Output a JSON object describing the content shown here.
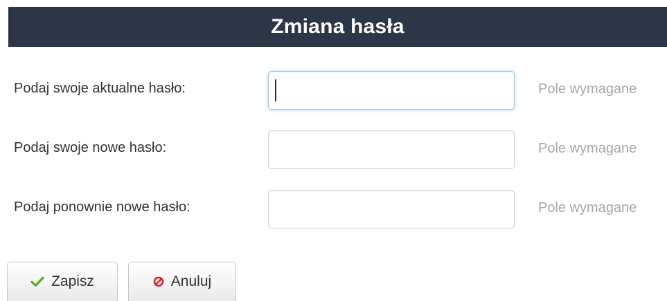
{
  "header": {
    "title": "Zmiana hasła"
  },
  "form": {
    "fields": [
      {
        "label": "Podaj swoje aktualne hasło:",
        "value": "",
        "hint": "Pole wymagane"
      },
      {
        "label": "Podaj swoje nowe hasło:",
        "value": "",
        "hint": "Pole wymagane"
      },
      {
        "label": "Podaj ponownie nowe hasło:",
        "value": "",
        "hint": "Pole wymagane"
      }
    ]
  },
  "actions": {
    "save_label": "Zapisz",
    "save_icon": "checkmark-icon",
    "cancel_label": "Anuluj",
    "cancel_icon": "prohibited-icon"
  },
  "colors": {
    "header_bg": "#2c3648",
    "check_green": "#4caf1a",
    "cancel_red": "#d9232d"
  }
}
